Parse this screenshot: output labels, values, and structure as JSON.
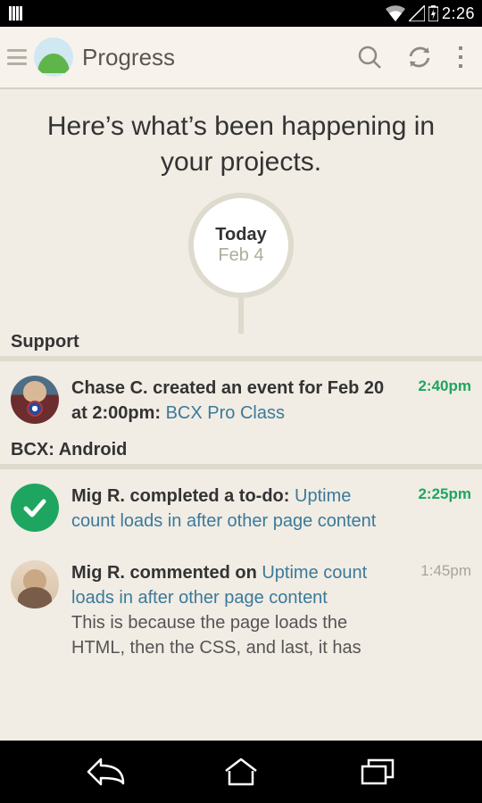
{
  "status": {
    "time": "2:26"
  },
  "header": {
    "title": "Progress"
  },
  "headline": "Here’s what’s been happening in your projects.",
  "bubble": {
    "line1": "Today",
    "line2": "Feb 4"
  },
  "sections": [
    {
      "title": "Support",
      "items": [
        {
          "avatar": "chase",
          "lead": "Chase C. created an event for Feb 20 at 2:00pm: ",
          "link": "BCX Pro Class",
          "comment": "",
          "time": "2:40pm",
          "recent": true
        }
      ]
    },
    {
      "title": "BCX: Android",
      "items": [
        {
          "avatar": "check",
          "lead": "Mig R. completed a to-do: ",
          "link": "Uptime count loads in after other page content",
          "comment": "",
          "time": "2:25pm",
          "recent": true
        },
        {
          "avatar": "person",
          "lead": "Mig R. commented on ",
          "link": "Uptime count loads in after other page content",
          "comment": "This is because the page loads the HTML, then the CSS, and last, it has",
          "time": "1:45pm",
          "recent": false
        }
      ]
    }
  ]
}
